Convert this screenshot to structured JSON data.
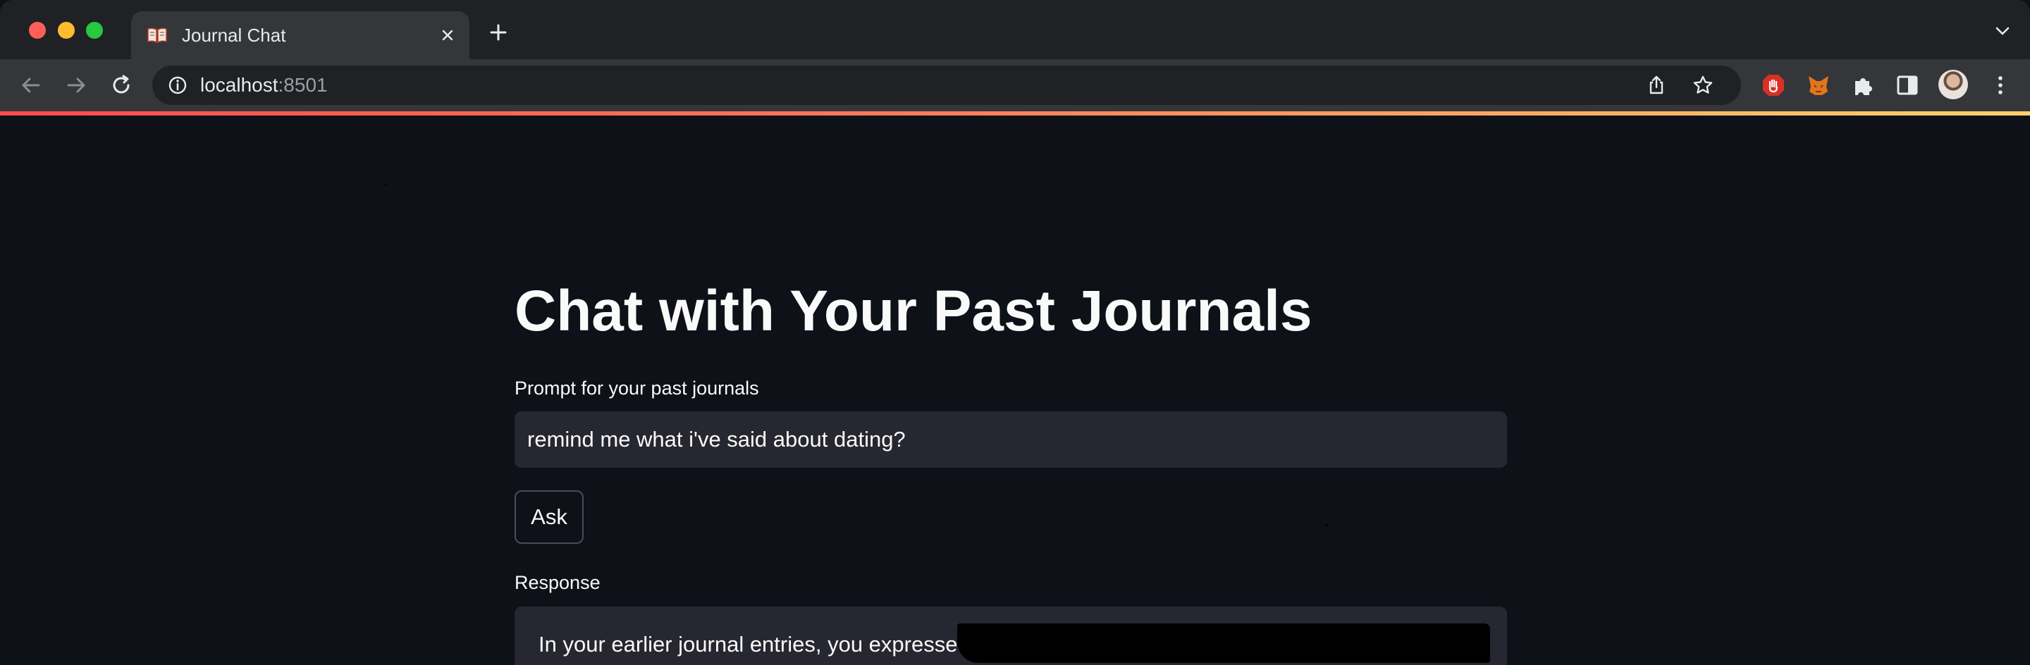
{
  "browser": {
    "tab": {
      "title": "Journal Chat",
      "favicon": "open-book-icon"
    },
    "address": {
      "host": "localhost",
      "port": ":8501"
    },
    "extensions": [
      "adblock-icon",
      "fox-wallet-icon",
      "puzzle-icon",
      "side-panel-icon"
    ]
  },
  "app": {
    "title": "Chat with Your Past Journals",
    "prompt": {
      "label": "Prompt for your past journals",
      "value": "remind me what i've said about dating?"
    },
    "ask_button": "Ask",
    "response": {
      "label": "Response",
      "text": "In your earlier journal entries, you expressed"
    }
  },
  "colors": {
    "background": "#0e1117",
    "surface": "#262730",
    "text": "#fafafa",
    "accent_gradient": [
      "#ff4b4b",
      "#ffd16a"
    ]
  }
}
